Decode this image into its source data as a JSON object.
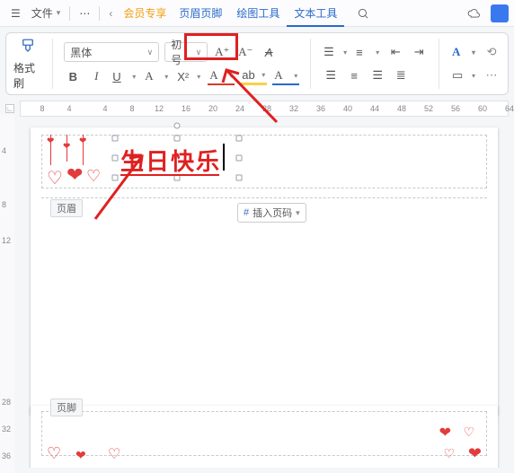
{
  "menubar": {
    "file": "文件",
    "vip": "会员专享",
    "tabs": [
      "页眉页脚",
      "绘图工具",
      "文本工具"
    ],
    "active_tab": 2
  },
  "ribbon": {
    "format_painter": "格式刷",
    "font_name": "黑体",
    "font_size": "初号",
    "bold": "B",
    "italic": "I",
    "underline": "U",
    "font_a": "A",
    "sup": "X²",
    "a_plus": "A⁺",
    "a_minus": "A⁻",
    "clear": "A",
    "abc": "ab"
  },
  "ruler": {
    "marks": [
      8,
      4,
      4,
      8,
      12,
      16,
      20,
      24,
      28,
      32,
      36,
      40,
      44,
      48,
      52,
      56,
      60,
      64
    ]
  },
  "vruler": {
    "marks": [
      4,
      8,
      12,
      28,
      32,
      36
    ]
  },
  "page": {
    "header_tag": "页眉",
    "footer_tag": "页脚",
    "insert_pg_num": "插入页码",
    "birthday_text": "生日快乐"
  },
  "colors": {
    "accent": "#e02020"
  }
}
